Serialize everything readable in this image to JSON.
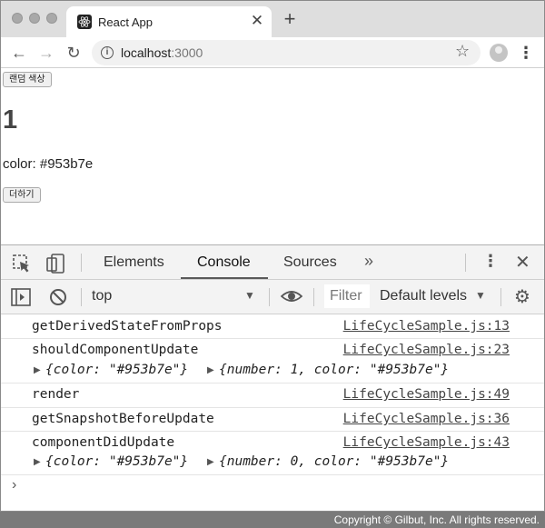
{
  "browser": {
    "tab_title": "React App",
    "url_host": "localhost",
    "url_port": ":3000"
  },
  "app": {
    "random_color_button": "랜덤 색상",
    "number": "1",
    "color_label": "color: #953b7e",
    "add_button": "더하기"
  },
  "devtools": {
    "tabs": [
      "Elements",
      "Console",
      "Sources"
    ],
    "active_tab": "Console",
    "context": "top",
    "filter_placeholder": "Filter",
    "levels": "Default levels"
  },
  "console": [
    {
      "message": "getDerivedStateFromProps",
      "source": "LifeCycleSample.js:13"
    },
    {
      "message": "shouldComponentUpdate",
      "source": "LifeCycleSample.js:23",
      "args": [
        "{color: \"#953b7e\"}",
        "{number: 1, color: \"#953b7e\"}"
      ]
    },
    {
      "message": "render",
      "source": "LifeCycleSample.js:49"
    },
    {
      "message": "getSnapshotBeforeUpdate",
      "source": "LifeCycleSample.js:36"
    },
    {
      "message": "componentDidUpdate",
      "source": "LifeCycleSample.js:43",
      "args": [
        "{color: \"#953b7e\"}",
        "{number: 0, color: \"#953b7e\"}"
      ]
    }
  ],
  "footer": {
    "copyright": "Copyright © Gilbut, Inc. All rights reserved."
  }
}
